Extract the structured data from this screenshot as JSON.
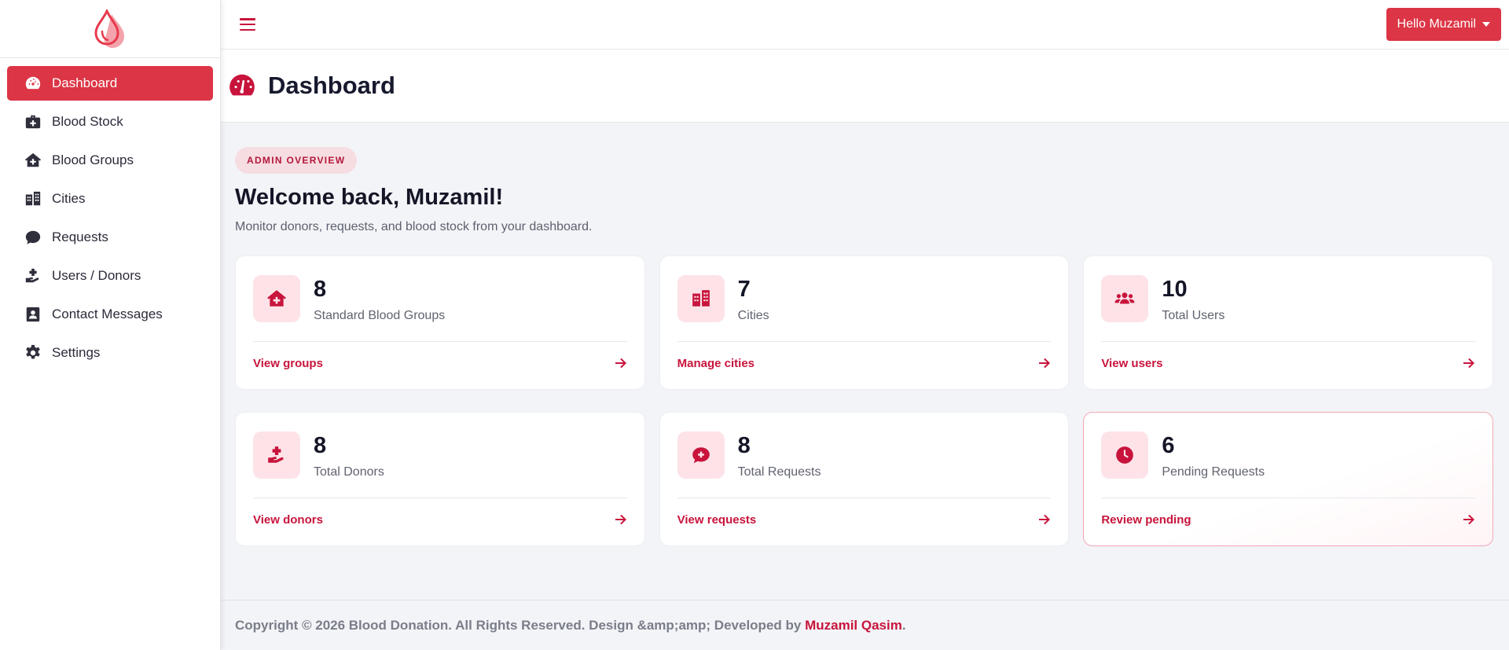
{
  "sidebar": {
    "items": [
      {
        "label": "Dashboard",
        "icon": "dashboard-icon",
        "active": true
      },
      {
        "label": "Blood Stock",
        "icon": "medical-kit-icon"
      },
      {
        "label": "Blood Groups",
        "icon": "house-medical-icon"
      },
      {
        "label": "Cities",
        "icon": "city-icon"
      },
      {
        "label": "Requests",
        "icon": "comment-medical-icon"
      },
      {
        "label": "Users / Donors",
        "icon": "hand-holding-medical-icon"
      },
      {
        "label": "Contact Messages",
        "icon": "address-card-icon"
      },
      {
        "label": "Settings",
        "icon": "gear-icon"
      }
    ]
  },
  "topbar": {
    "user_label": "Hello Muzamil"
  },
  "page": {
    "title": "Dashboard"
  },
  "main": {
    "badge": "ADMIN OVERVIEW",
    "welcome": "Welcome back, Muzamil!",
    "subtitle": "Monitor donors, requests, and blood stock from your dashboard.",
    "cards": [
      {
        "value": "8",
        "label": "Standard Blood Groups",
        "link": "View groups",
        "icon": "house-medical-icon"
      },
      {
        "value": "7",
        "label": "Cities",
        "link": "Manage cities",
        "icon": "city-icon"
      },
      {
        "value": "10",
        "label": "Total Users",
        "link": "View users",
        "icon": "users-icon"
      },
      {
        "value": "8",
        "label": "Total Donors",
        "link": "View donors",
        "icon": "hand-holding-medical-icon"
      },
      {
        "value": "8",
        "label": "Total Requests",
        "link": "View requests",
        "icon": "comment-medical-icon"
      },
      {
        "value": "6",
        "label": "Pending Requests",
        "link": "Review pending",
        "icon": "clock-icon"
      }
    ]
  },
  "footer": {
    "text": "Copyright © 2026 Blood Donation. All Rights Reserved. Design &amp;amp; Developed by ",
    "author": "Muzamil Qasim",
    "end": "."
  },
  "colors": {
    "accent": "#dc3545",
    "brand": "#c8143c",
    "icon_bg": "#fde3e8"
  }
}
